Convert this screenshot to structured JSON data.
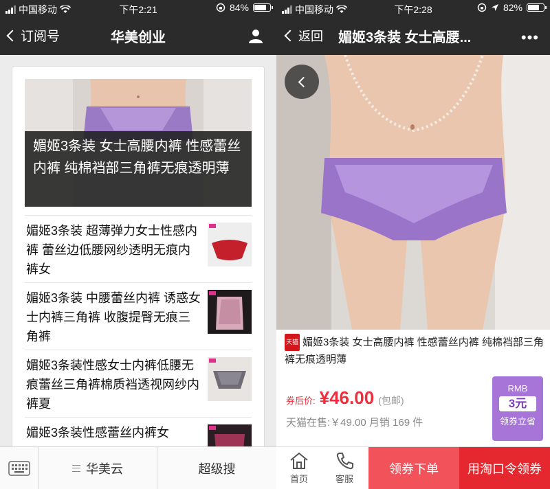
{
  "left": {
    "status": {
      "carrier": "中国移动",
      "time": "下午2:21",
      "battery": "84%",
      "battery_level": 0.84
    },
    "nav": {
      "back_label": "订阅号",
      "title": "华美创业"
    },
    "featured": {
      "caption": "媚姬3条装 女士高腰内裤 性感蕾丝内裤 纯棉裆部三角裤无痕透明薄"
    },
    "articles": [
      {
        "title": "媚姬3条装 超薄弹力女士性感内裤 蕾丝边低腰网纱透明无痕内裤女"
      },
      {
        "title": "媚姬3条装 中腰蕾丝内裤 诱惑女士内裤三角裤 收腹提臀无痕三角裤"
      },
      {
        "title": "媚姬3条装性感女士内裤低腰无痕蕾丝三角裤棉质裆透视网纱内裤夏"
      },
      {
        "title": "媚姬3条装性感蕾丝内裤女"
      }
    ],
    "bottom_menu": {
      "item1": "华美云",
      "item2": "超级搜"
    }
  },
  "right": {
    "status": {
      "carrier": "中国移动",
      "time": "下午2:28",
      "battery": "82%",
      "battery_level": 0.82
    },
    "nav": {
      "back_label": "返回",
      "title": "媚姬3条装 女士高腰...",
      "more": "•••"
    },
    "product": {
      "badge": "天猫",
      "name": "媚姬3条装 女士高腰内裤 性感蕾丝内裤 纯棉裆部三角裤无痕透明薄",
      "price_label": "券后价:",
      "price": "¥46.00",
      "shipping": "(包邮)",
      "tmall_info": "天猫在售:￥49.00 月销 169 件"
    },
    "coupon": {
      "currency": "RMB",
      "amount": "3元",
      "action": "领券立省"
    },
    "bottom": {
      "home": "首页",
      "service": "客服",
      "btn1": "领券下单",
      "btn2": "用淘口令领券"
    }
  },
  "colors": {
    "nav_bg": "#2b2b2b",
    "price_red": "#f02d3c",
    "coupon_purple": "#a774d8",
    "btn_red1": "#f2525a",
    "btn_red2": "#e5282f"
  }
}
